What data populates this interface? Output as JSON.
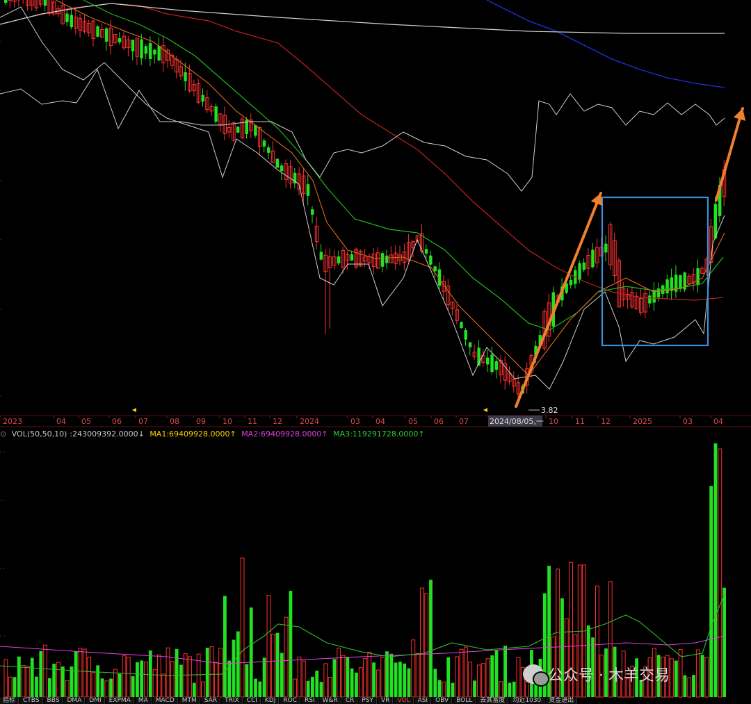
{
  "chart_data": {
    "type": "candlestick",
    "title": "",
    "x_ticks": [
      "2023",
      "04",
      "05",
      "06",
      "07",
      "08",
      "09",
      "10",
      "11",
      "12",
      "2024",
      "03",
      "04",
      "05",
      "06",
      "07",
      "2024/08/05,一",
      "10",
      "11",
      "12",
      "2025",
      "03",
      "04"
    ],
    "min_price_label": "3.82",
    "highlight": {
      "label": "consolidation box",
      "color": "#3a8fd8"
    },
    "arrows": [
      {
        "name": "rally-arrow-1",
        "from": "2024/08/05",
        "to": "2024/12",
        "color": "#f08030"
      },
      {
        "name": "rally-arrow-2",
        "from": "2025/04",
        "to": "2025/04",
        "color": "#f08030"
      }
    ],
    "volume_indicator": {
      "name": "VOL(50,50,10)",
      "value": ":243009392.0000↓",
      "ma1": "MA1:69409928.0000↑",
      "ma2": "MA2:69409928.0000↑",
      "ma3": "MA3:119291728.0000↑",
      "colors": {
        "name": "#c8c8c8",
        "ma1": "#ffd400",
        "ma2": "#e040e0",
        "ma3": "#30d030"
      }
    },
    "colors": {
      "up": "#ff3030",
      "down": "#22e022",
      "ma_short": "#e06a1a",
      "ma_mid": "#1fb81f",
      "ma_long": "#c02020",
      "ma_very_long": "#2030e0",
      "ma_flat": "#d0d0d0",
      "index_line": "#d0d0d0"
    }
  },
  "tabs": [
    "指标",
    "CTBS",
    "BBS",
    "DMA",
    "DMI",
    "EXPMA",
    "MA",
    "MACD",
    "MTM",
    "SAR",
    "TRIX",
    "CCI",
    "KDJ",
    "ROC",
    "RSI",
    "W&R",
    "CR",
    "PSY",
    "VR",
    "VOL",
    "ASI",
    "OBV",
    "BOLL",
    "去其富度",
    "均近1030",
    "资金进出"
  ],
  "active_tab": "VOL",
  "watermark": {
    "text": "公众号 · 木羊交易"
  }
}
